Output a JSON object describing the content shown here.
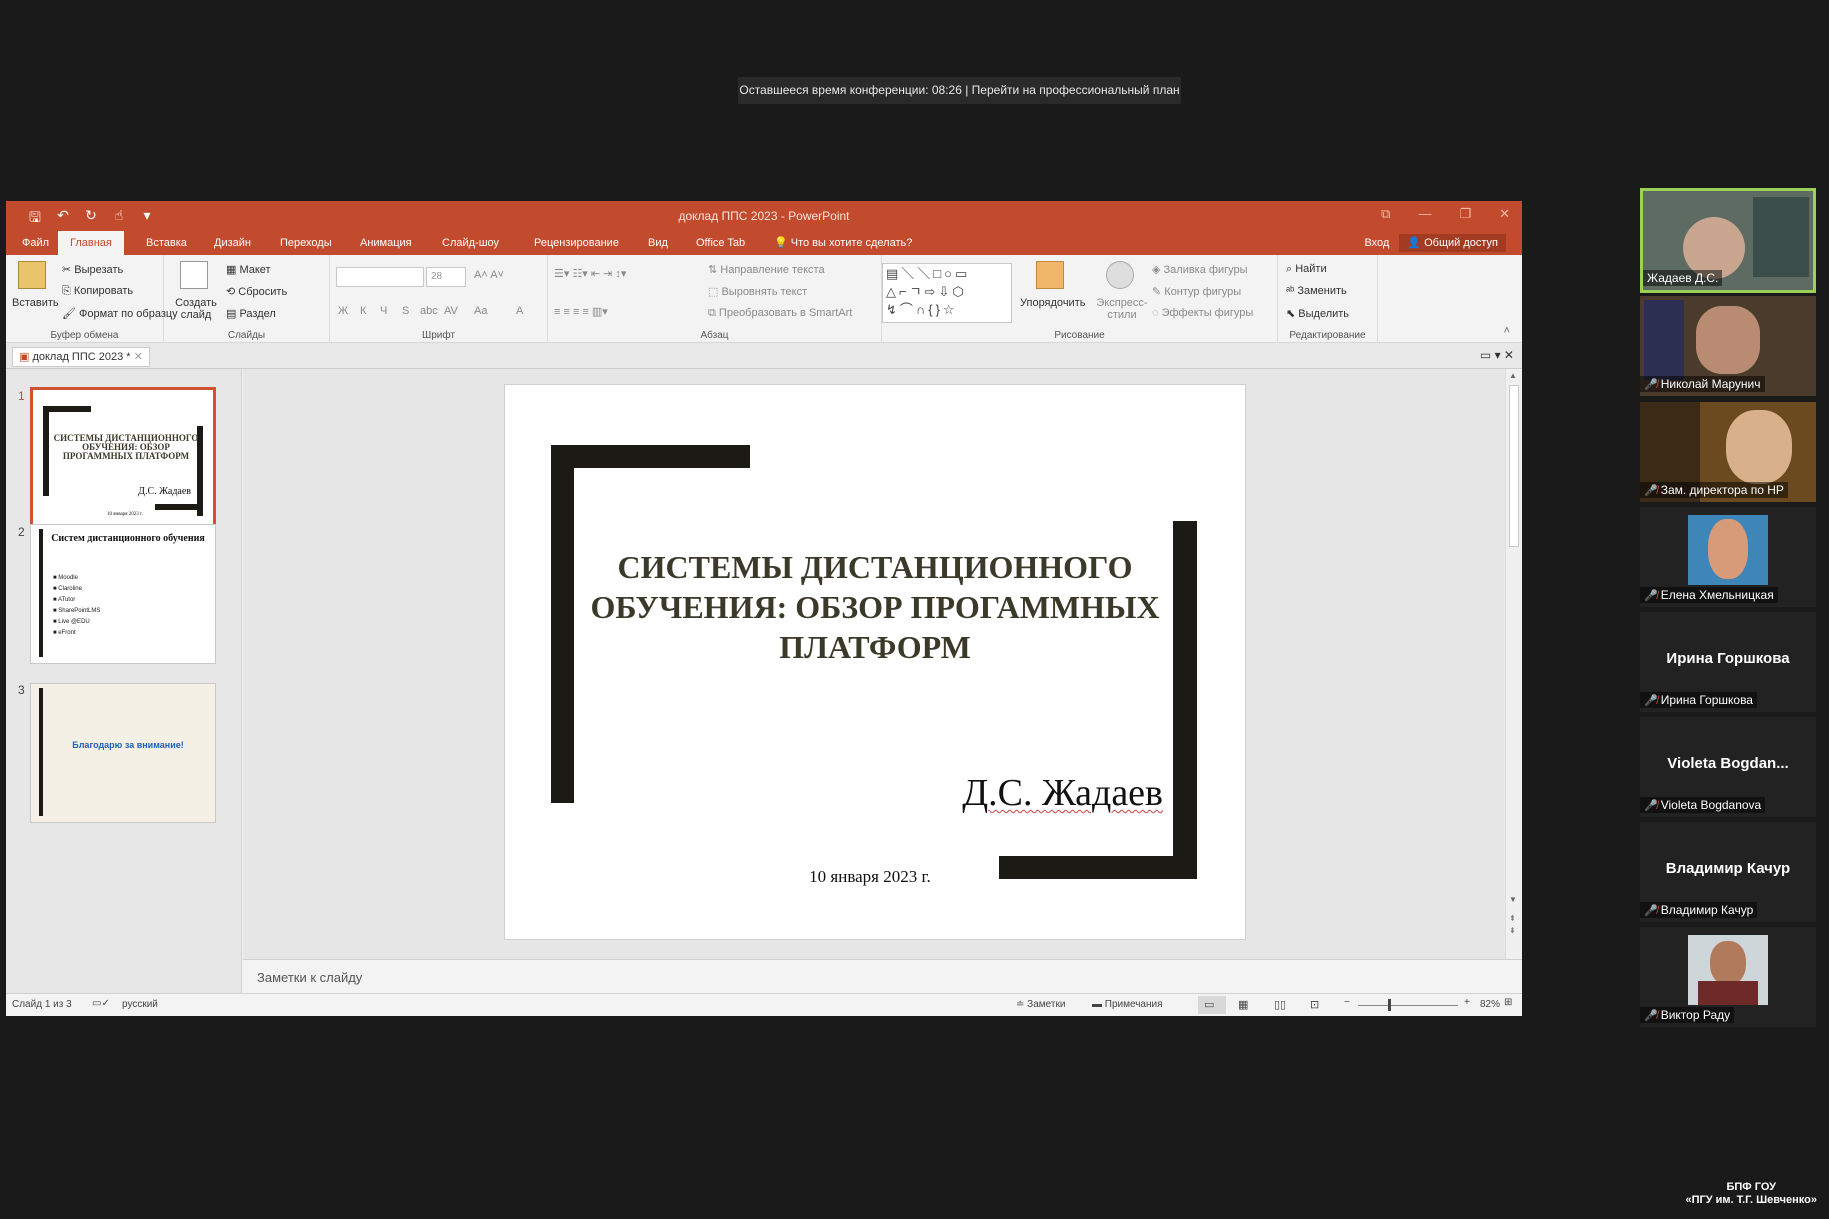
{
  "banner": {
    "text": "Оставшееся время конференции: 08:26 | Перейти на профессиональный план"
  },
  "window": {
    "title": "доклад ППС 2023 - PowerPoint",
    "controls": [
      "⧉",
      "—",
      "❐",
      "✕"
    ]
  },
  "qat": {
    "save": "🖫",
    "undo": "↶",
    "redo": "↻",
    "touch": "☝",
    "more": "▾"
  },
  "menu": {
    "tabs": [
      "Файл",
      "Главная",
      "Вставка",
      "Дизайн",
      "Переходы",
      "Анимация",
      "Слайд-шоу",
      "Рецензирование",
      "Вид",
      "Office Tab"
    ],
    "active_tab": "Главная",
    "tell_me": "Что вы хотите сделать?",
    "signin": "Вход",
    "share": "Общий доступ"
  },
  "ribbon": {
    "clipboard": {
      "label": "Буфер обмена",
      "paste": "Вставить",
      "cut": "Вырезать",
      "copy": "Копировать",
      "format_painter": "Формат по образцу"
    },
    "slides": {
      "label": "Слайды",
      "new_slide": "Создать слайд",
      "layout": "Макет",
      "reset": "Сбросить",
      "section": "Раздел"
    },
    "font": {
      "label": "Шрифт",
      "size": "28",
      "bold": "Ж",
      "italic": "К",
      "underline": "Ч",
      "shadow": "S",
      "strike": "abc",
      "spacing": "AV",
      "case": "Aa",
      "color": "A"
    },
    "paragraph": {
      "label": "Абзац",
      "text_dir": "Направление текста",
      "align_text": "Выровнять текст",
      "smartart": "Преобразовать в SmartArt"
    },
    "drawing": {
      "label": "Рисование",
      "arrange": "Упорядочить",
      "quick_styles": "Экспресс-стили",
      "fill": "Заливка фигуры",
      "outline": "Контур фигуры",
      "effects": "Эффекты фигуры"
    },
    "editing": {
      "label": "Редактирование",
      "find": "Найти",
      "replace": "Заменить",
      "select": "Выделить"
    }
  },
  "doc_tab": {
    "label": "доклад ППС 2023 *"
  },
  "thumbnails": [
    {
      "num": "1",
      "title": "СИСТЕМЫ ДИСТАНЦИОННОГО ОБУЧЕНИЯ: ОБЗОР ПРОГАММНЫХ ПЛАТФОРМ",
      "author": "Д.С. Жадаев",
      "date": "10 января 2023 г."
    },
    {
      "num": "2",
      "title": "Систем дистанционного обучения",
      "bullets": [
        "Moodle",
        "Claroline",
        "ATutor",
        "SharePointLMS",
        "Live @EDU",
        "eFront"
      ]
    },
    {
      "num": "3",
      "title": "Благодарю за внимание!"
    }
  ],
  "slide": {
    "title": "СИСТЕМЫ ДИСТАНЦИОННОГО ОБУЧЕНИЯ: ОБЗОР ПРОГАММНЫХ ПЛАТФОРМ",
    "author": "Д.С. Жадаев",
    "date": "10 января 2023 г."
  },
  "notes": {
    "placeholder": "Заметки к слайду"
  },
  "status": {
    "slide_info": "Слайд 1 из 3",
    "language": "русский",
    "notes_btn": "Заметки",
    "comments_btn": "Примечания",
    "zoom": "82%"
  },
  "participants": [
    {
      "name": "Жадаев Д.С.",
      "video": true,
      "active": true
    },
    {
      "name": "Николай Марунич",
      "video": true
    },
    {
      "name": "Зам. директора по НР",
      "video": true
    },
    {
      "name": "Елена Хмельницкая",
      "video": true
    },
    {
      "name": "Ирина Горшкова",
      "center": "Ирина Горшкова"
    },
    {
      "name": "Violeta Bogdanova",
      "center": "Violeta  Bogdan..."
    },
    {
      "name": "Владимир Качур",
      "center": "Владимир Качур"
    },
    {
      "name": "Виктор Раду",
      "video": true
    }
  ],
  "watermark": {
    "line1": "БПФ ГОУ",
    "line2": "«ПГУ им. Т.Г. Шевченко»"
  },
  "colors": {
    "accent": "#c24a2d",
    "frame": "#1c1a14",
    "title_text": "#3b3a2a"
  }
}
